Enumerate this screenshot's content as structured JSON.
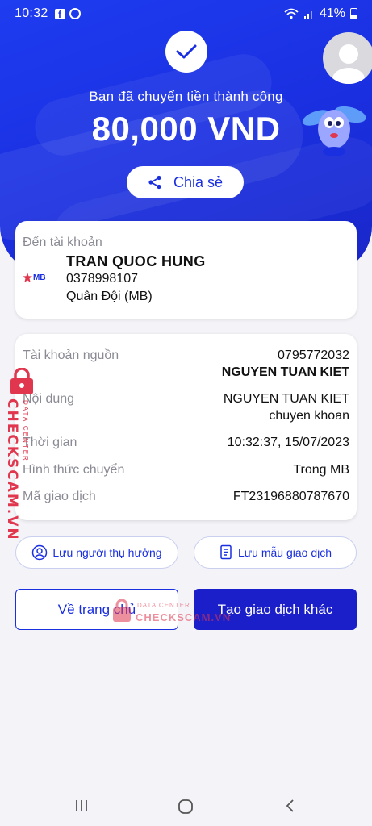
{
  "status_bar": {
    "time": "10:32",
    "battery": "41%"
  },
  "hero": {
    "success_message": "Bạn đã chuyển tiền thành công",
    "amount": "80,000 VND",
    "share_label": "Chia sẻ"
  },
  "recipient": {
    "label": "Đến tài khoản",
    "bank_logo_text": "MB",
    "name": "TRAN QUOC HUNG",
    "account_number": "0378998107",
    "bank_name": "Quân Đội (MB)"
  },
  "details": {
    "source_label": "Tài khoản nguồn",
    "source_account": "0795772032",
    "source_name": "NGUYEN TUAN KIET",
    "content_label": "Nội dung",
    "content_line1": "NGUYEN TUAN KIET",
    "content_line2": "chuyen khoan",
    "time_label": "Thời gian",
    "time_value": "10:32:37, 15/07/2023",
    "method_label": "Hình thức chuyển",
    "method_value": "Trong MB",
    "txn_label": "Mã giao dịch",
    "txn_value": "FT23196880787670"
  },
  "actions": {
    "save_payee": "Lưu người thụ hưởng",
    "save_template": "Lưu mẫu giao dịch",
    "home": "Về trang chủ",
    "new_transaction": "Tạo giao dịch khác"
  },
  "watermark": {
    "brand": "CHECKSCAM.VN",
    "sub": "DATA CENTER"
  },
  "colors": {
    "primary": "#1a2fe0",
    "button_dark": "#1a1fc9",
    "watermark": "#e0374e"
  }
}
